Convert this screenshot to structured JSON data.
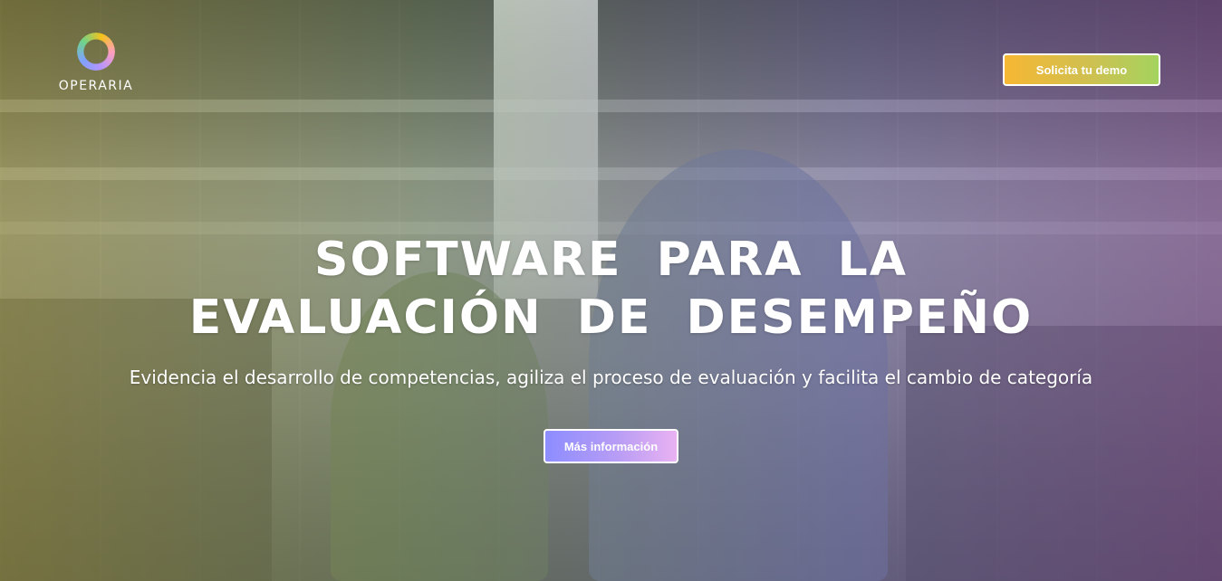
{
  "brand": {
    "logo_icon": "ring-logo-icon",
    "name": "OPERARIA",
    "colors": [
      "#f4c21a",
      "#ff9fbd",
      "#b394ff",
      "#7ea2ff",
      "#6fd38a"
    ]
  },
  "header": {
    "demo_button_label": "Solicita tu demo",
    "demo_button_colors": [
      "#f7b733",
      "#a4d35e"
    ]
  },
  "hero": {
    "title_line_1": "SOFTWARE PARA LA",
    "title_line_2": "EVALUACIÓN DE DESEMPEÑO",
    "subtitle": "Evidencia el desarrollo de competencias, agiliza el proceso de evaluación y facilita el cambio de categoría",
    "cta_label": "Más información",
    "cta_colors": [
      "#8d8dff",
      "#e9b2f2"
    ]
  }
}
